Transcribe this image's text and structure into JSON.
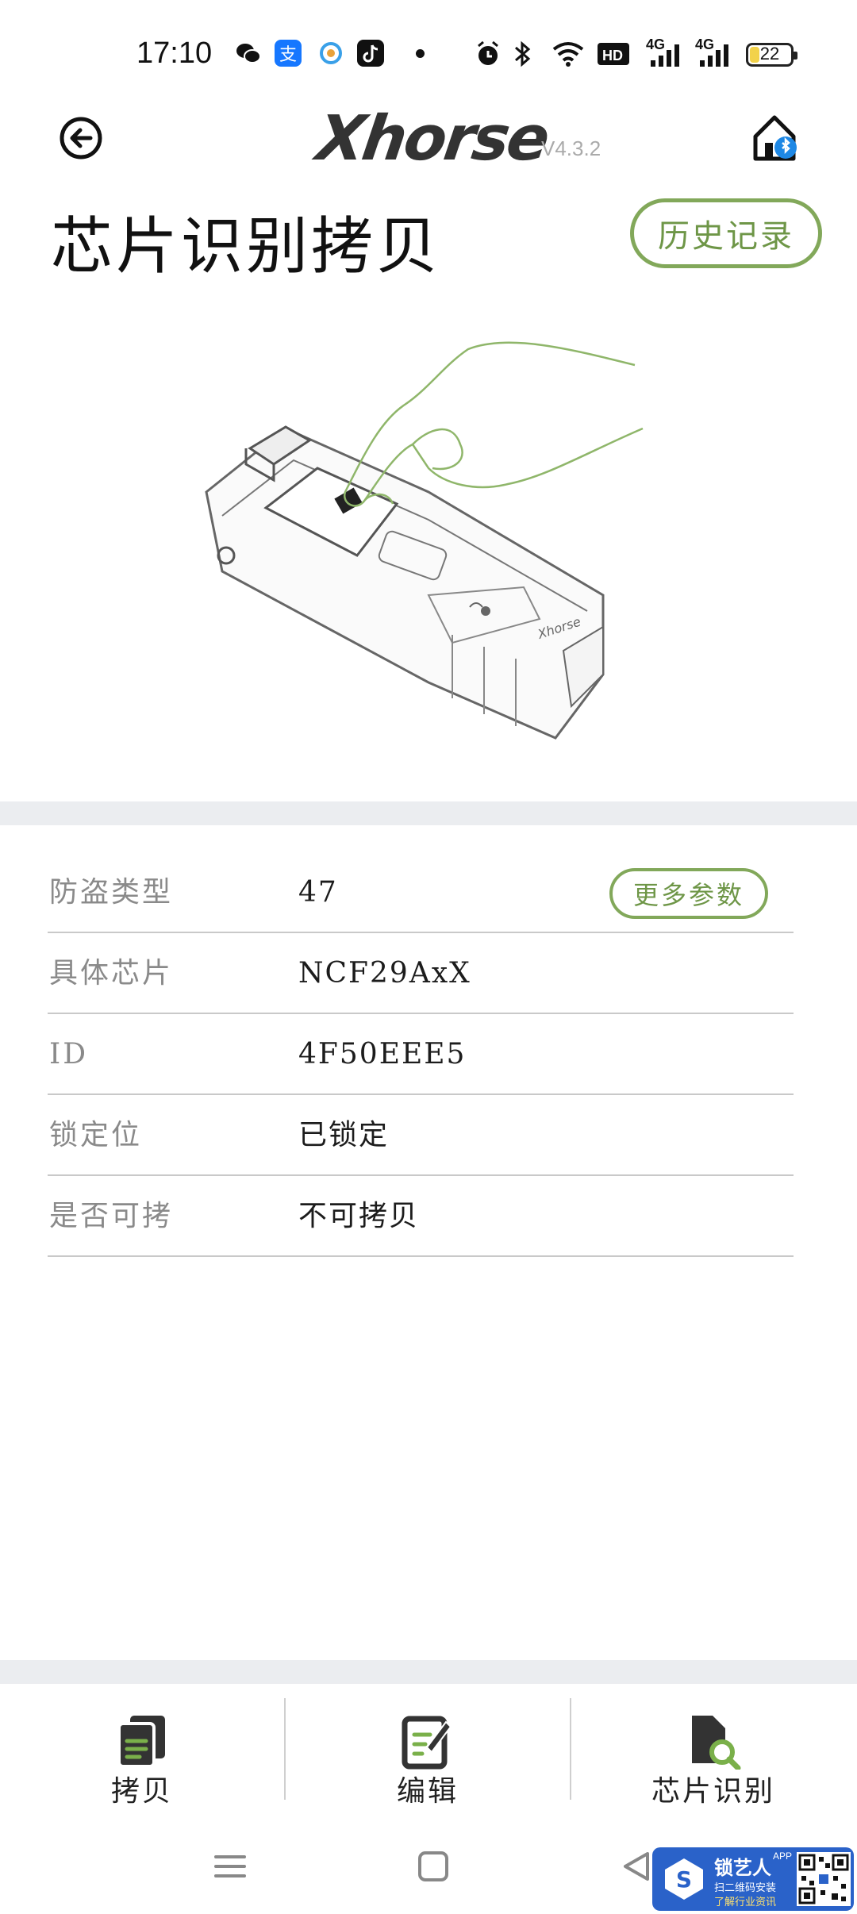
{
  "status_bar": {
    "time": "17:10",
    "net1": "4G",
    "net2": "4G",
    "hd_label": "HD",
    "battery_level": "22",
    "icons": [
      "wechat-icon",
      "alipay-icon",
      "app-icon",
      "tiktok-icon",
      "alarm-icon",
      "bluetooth-icon",
      "wifi-icon",
      "hd-icon",
      "signal-icon",
      "signal-icon",
      "battery-icon"
    ]
  },
  "header": {
    "logo_text": "Xhorse",
    "version": "V4.3.2"
  },
  "page_title": "芯片识别拷贝",
  "history_button": "历史记录",
  "info": {
    "more_params_button": "更多参数",
    "rows": [
      {
        "label": "防盗类型",
        "value": "47"
      },
      {
        "label": "具体芯片",
        "value": "NCF29AxX"
      },
      {
        "label": "ID",
        "value": "4F50EEE5"
      },
      {
        "label": "锁定位",
        "value": "已锁定"
      },
      {
        "label": "是否可拷",
        "value": "不可拷贝"
      }
    ]
  },
  "tabs": [
    {
      "label": "拷贝",
      "icon": "copy-icon"
    },
    {
      "label": "编辑",
      "icon": "edit-icon"
    },
    {
      "label": "芯片识别",
      "icon": "chip-identify-icon"
    }
  ],
  "watermark": {
    "title": "锁艺人",
    "app": "APP",
    "line1": "扫二维码安装",
    "line2": "了解行业资讯"
  },
  "colors": {
    "accent_green": "#82a85a",
    "divider_band": "#ebedf0"
  }
}
